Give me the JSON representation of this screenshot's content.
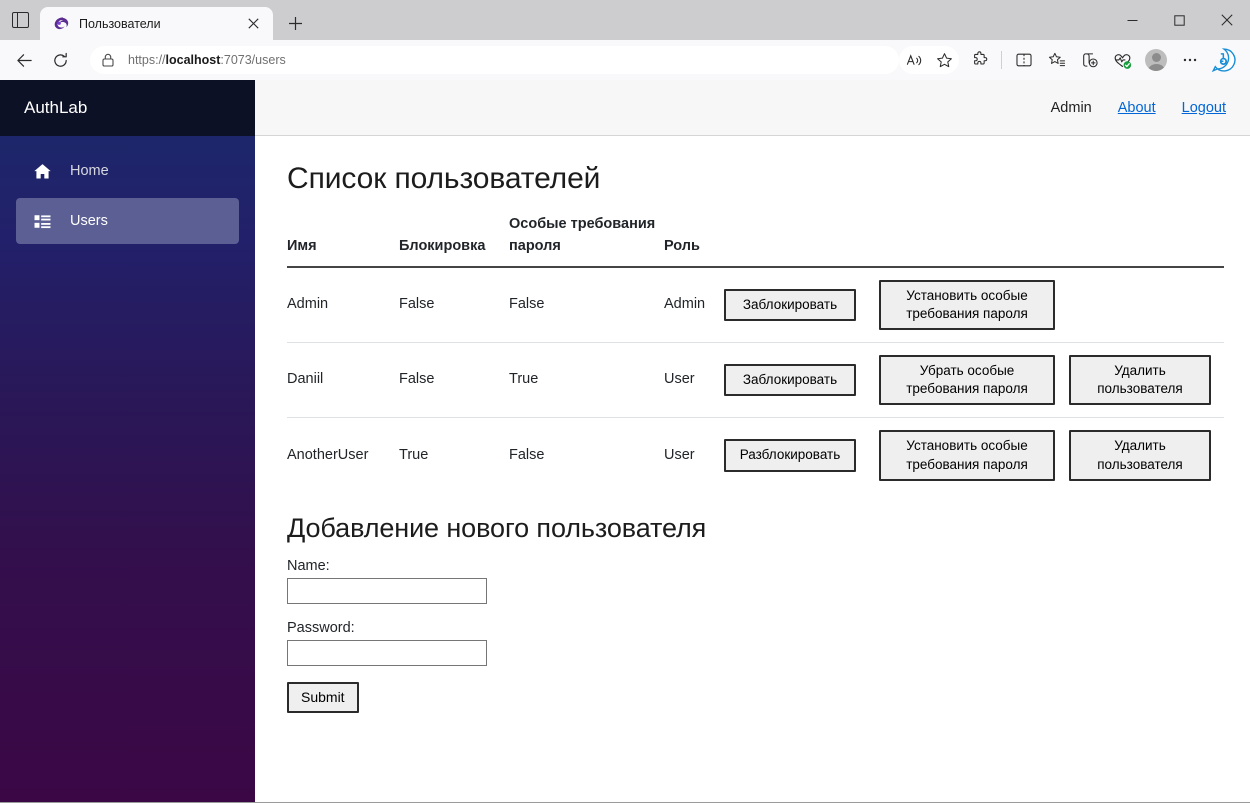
{
  "browser": {
    "tab": {
      "title": "Пользователи",
      "favicon_name": "blazor-logo-icon",
      "close_label": "×"
    },
    "new_tab_label": "+",
    "url_scheme": "https://",
    "url_host": "localhost",
    "url_rest": ":7073/users",
    "url_full": "https://localhost:7073/users",
    "window_controls": {
      "minimize": "—",
      "maximize": "□",
      "close": "✕"
    },
    "toolbar_icons": [
      "back-icon",
      "refresh-icon",
      "lock-icon",
      "read-aloud-icon",
      "favorite-star-icon",
      "extensions-icon",
      "split-screen-icon",
      "collections-icon",
      "add-to-collections-icon",
      "browser-essentials-icon",
      "profile-avatar-icon",
      "settings-more-icon",
      "copilot-icon"
    ]
  },
  "sidebar": {
    "brand": "AuthLab",
    "items": [
      {
        "label": "Home",
        "icon": "home-icon",
        "active": false
      },
      {
        "label": "Users",
        "icon": "list-users-icon",
        "active": true
      }
    ]
  },
  "topbar": {
    "username": "Admin",
    "about_label": "About",
    "logout_label": "Logout"
  },
  "page": {
    "title": "Список пользователей",
    "table": {
      "headers": [
        "Имя",
        "Блокировка",
        "Особые требования пароля",
        "Роль"
      ],
      "rows": [
        {
          "name": "Admin",
          "blocked": "False",
          "special_password": "False",
          "role": "Admin",
          "actions": [
            "Заблокировать",
            "Установить особые требования пароля"
          ]
        },
        {
          "name": "Daniil",
          "blocked": "False",
          "special_password": "True",
          "role": "User",
          "actions": [
            "Заблокировать",
            "Убрать особые требования пароля",
            "Удалить пользователя"
          ]
        },
        {
          "name": "AnotherUser",
          "blocked": "True",
          "special_password": "False",
          "role": "User",
          "actions": [
            "Разблокировать",
            "Установить особые требования пароля",
            "Удалить пользователя"
          ]
        }
      ]
    },
    "form": {
      "title": "Добавление нового пользователя",
      "name_label": "Name:",
      "name_value": "",
      "name_placeholder": "",
      "password_label": "Password:",
      "password_value": "",
      "password_placeholder": "",
      "submit_label": "Submit"
    }
  },
  "colors": {
    "sidebar_top": "#1b2a6b",
    "sidebar_bottom": "#3b0745",
    "brand_bar": "#0d1126",
    "nav_active": "#5b5f93",
    "link": "#0366d6",
    "table_header_border": "#454545",
    "table_row_border": "#dee2e6",
    "button_face": "#efefef",
    "button_border": "#2b2b2b"
  }
}
